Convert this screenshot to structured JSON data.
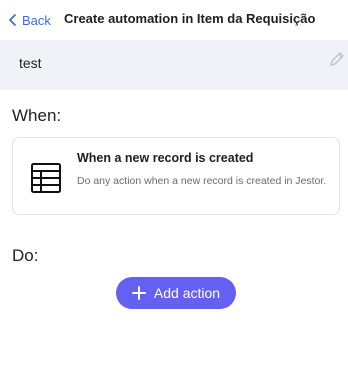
{
  "header": {
    "back_label": "Back",
    "title": "Create automation in Item da Requisição"
  },
  "automation": {
    "name": "test"
  },
  "when": {
    "heading": "When:",
    "trigger": {
      "icon": "table-icon",
      "title": "When a new record is created",
      "description": "Do any action when a new record is created in Jestor."
    }
  },
  "do": {
    "heading": "Do:",
    "add_action_label": "Add action"
  },
  "colors": {
    "accent": "#6461f2",
    "link": "#3b6fe0",
    "name_bar_bg": "#f1f2f7"
  }
}
